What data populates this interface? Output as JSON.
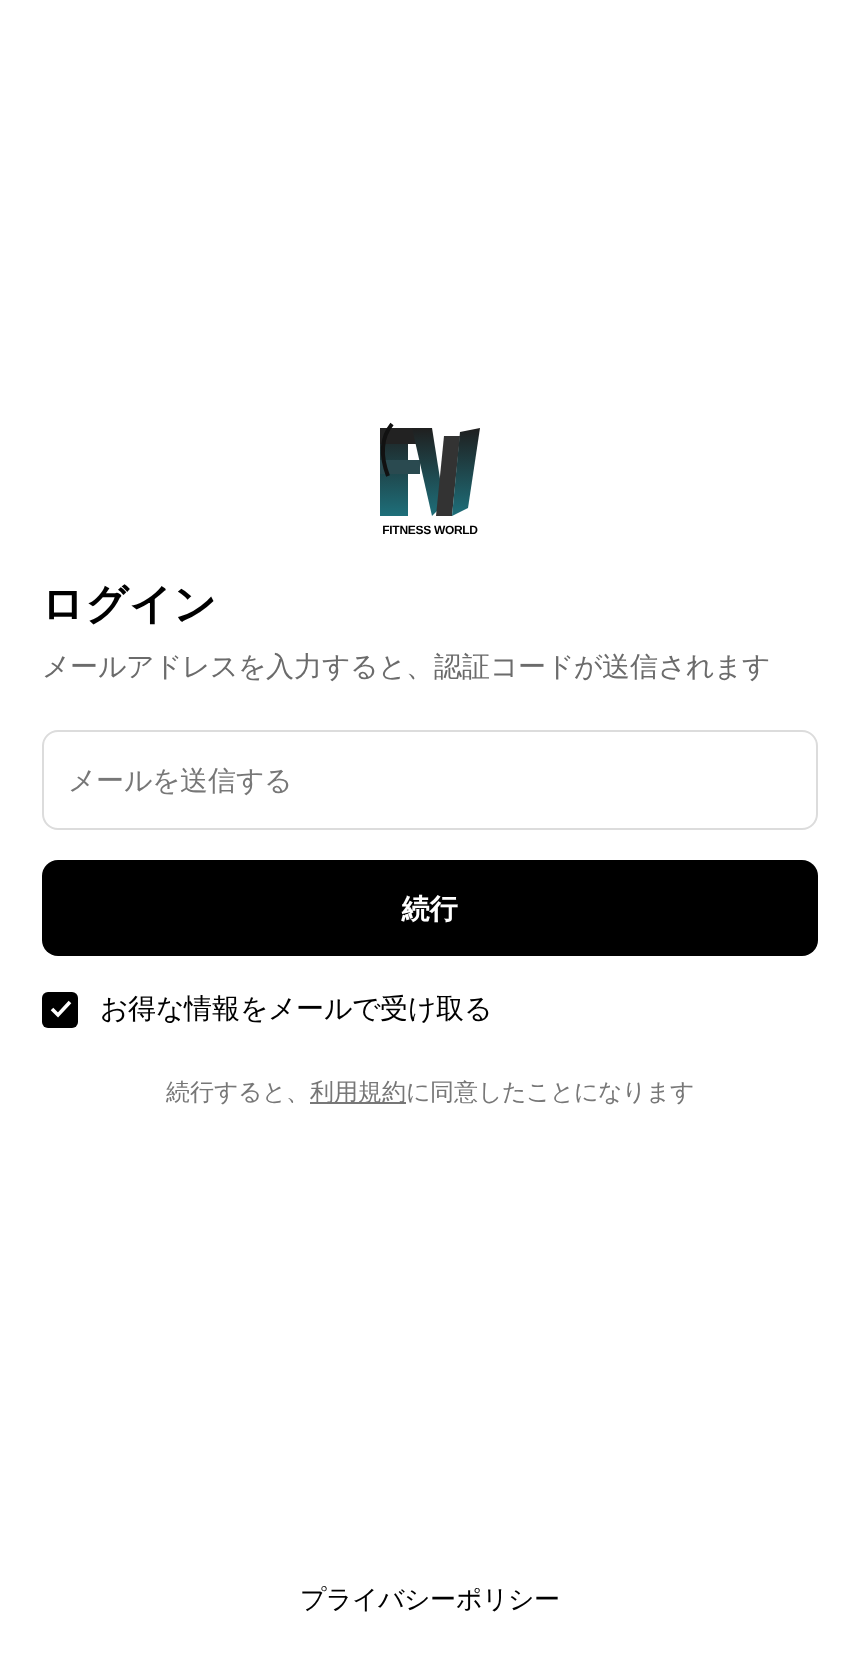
{
  "logo": {
    "caption": "FITNESS WORLD"
  },
  "title": "ログイン",
  "subtitle": "メールアドレスを入力すると、認証コードが送信されます",
  "email_field": {
    "placeholder": "メールを送信する"
  },
  "continue_button": "続行",
  "newsletter": {
    "label": "お得な情報をメールで受け取る",
    "checked": true
  },
  "terms": {
    "before": "続行すると、",
    "link": "利用規約",
    "after": "に同意したことになります"
  },
  "footer_link": "プライバシーポリシー"
}
